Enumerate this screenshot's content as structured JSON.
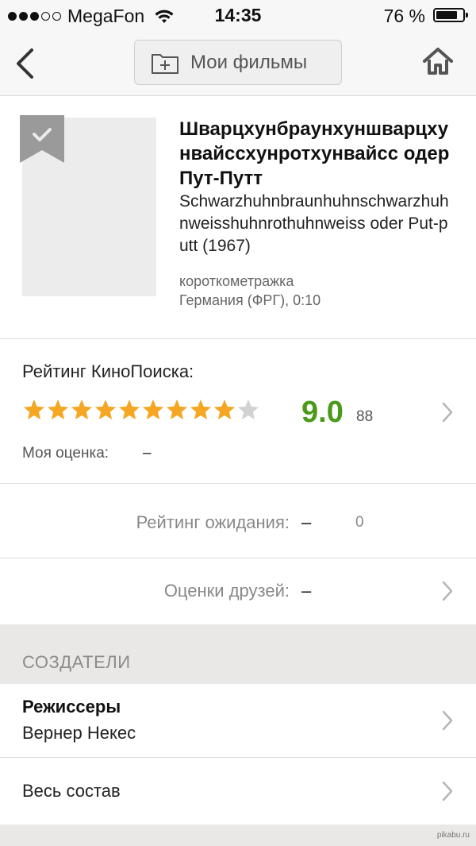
{
  "status_bar": {
    "carrier": "MegaFon",
    "signal_bars_filled": 3,
    "signal_bars_total": 5,
    "time": "14:35",
    "battery": "76 %",
    "battery_level": 0.76
  },
  "nav": {
    "center_button_label": "Мои фильмы",
    "icons": [
      "back-chevron-icon",
      "folder-add-icon",
      "home-icon"
    ]
  },
  "film": {
    "title_ru": "Шварцхунбраунхуншварцхунвайссхунротхунвайсс одер Пут-Путт",
    "title_original": "Schwarzhuhnbraunhuhnschwarzhuhnweisshuhnrothuhnweiss oder Put-putt (1967)",
    "genre": "короткометражка",
    "country_duration": "Германия (ФРГ), 0:10",
    "bookmark_icon": "bookmark-check-icon"
  },
  "rating": {
    "label": "Рейтинг КиноПоиска:",
    "value": "9.0",
    "votes": "88",
    "stars_filled": 9,
    "stars_total": 10,
    "star_color": "#f5a623",
    "value_color": "#4a9a1a",
    "my_label": "Моя оценка:",
    "my_value": "–"
  },
  "expectation": {
    "label": "Рейтинг ожидания:",
    "value": "–",
    "count": "0"
  },
  "friends": {
    "label": "Оценки друзей:",
    "value": "–"
  },
  "creators": {
    "section_title": "СОЗДАТЕЛИ",
    "directors_label": "Режиссеры",
    "directors_name": "Вернер Некес",
    "cast_label": "Весь состав"
  },
  "watermark": "pikabu.ru"
}
